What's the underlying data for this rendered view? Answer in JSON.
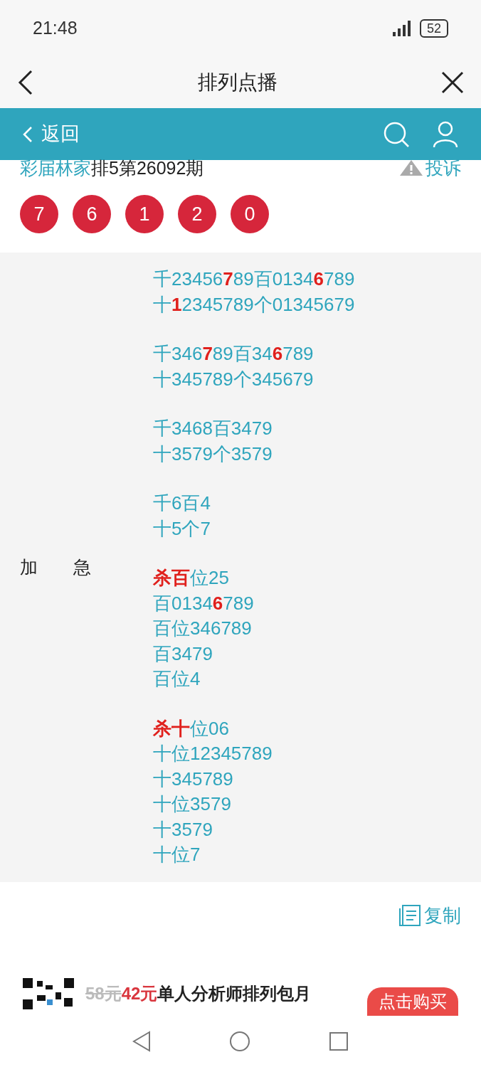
{
  "status_bar": {
    "time": "21:48",
    "battery": "52"
  },
  "title_bar": {
    "title": "排列点播"
  },
  "nav_bar": {
    "back": "返回"
  },
  "issue": {
    "author": "彩届林家",
    "title": "排5第26092期",
    "report": "投诉"
  },
  "balls": [
    "7",
    "6",
    "1",
    "2",
    "0"
  ],
  "prediction": {
    "label": "加　　急",
    "groups": [
      [
        "千23456**7**89百0134**6**789",
        "十**1**2345789个01345679"
      ],
      [
        "千346**7**89百34**6**789",
        "十345789个345679"
      ],
      [
        "千3468百3479",
        "十3579个3579"
      ],
      [
        "千6百4",
        "十5个7"
      ],
      [
        "**杀百**位25",
        "百0134**6**789",
        "百位346789",
        "百3479",
        "百位4"
      ],
      [
        "**杀十**位06",
        "十位12345789",
        "十345789",
        "十位3579",
        "十3579",
        "十位7"
      ]
    ]
  },
  "copy": "复制",
  "ad": {
    "old_price": "58元",
    "new_price": "42元",
    "text": "单人分析师排列包月",
    "button": "点击购买"
  }
}
